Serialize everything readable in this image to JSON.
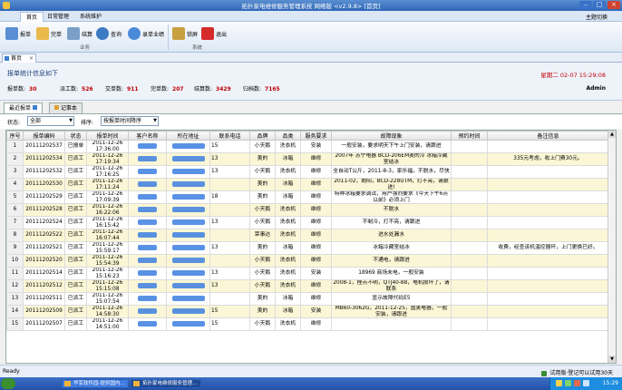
{
  "window": {
    "title": "拓扑家电维修服务管理系统 网络版 <v2.9.8> [首页]",
    "icons": {
      "app": "app-icon",
      "minimize": "minimize-icon",
      "maximize": "maximize-icon",
      "close": "close-icon"
    }
  },
  "menu": {
    "tabs": [
      "首页",
      "日常管理",
      "系统维护"
    ],
    "active": "首页",
    "theme": "主题切换"
  },
  "toolbar": {
    "buttons": [
      {
        "label": "报单",
        "icon": "report-icon"
      },
      {
        "label": "完单",
        "icon": "complete-icon"
      },
      {
        "label": "结算",
        "icon": "settle-icon"
      },
      {
        "label": "查询",
        "icon": "search-icon"
      },
      {
        "label": "录单业绩",
        "icon": "user-icon"
      },
      {
        "label": "锁屏",
        "icon": "lock-icon"
      },
      {
        "label": "退出",
        "icon": "exit-icon"
      }
    ],
    "groups": [
      "业务",
      "系统"
    ]
  },
  "doc_tab": {
    "label": "首页"
  },
  "stats": {
    "title": "报单统计信息如下",
    "datetime": "星期二 02-07 15:29:08",
    "user": "Admin",
    "items": [
      {
        "label": "报单数:",
        "value": "30"
      },
      {
        "label": "派工数:",
        "value": "526"
      },
      {
        "label": "交单数:",
        "value": "911"
      },
      {
        "label": "完单数:",
        "value": "207"
      },
      {
        "label": "结算数:",
        "value": "3429"
      },
      {
        "label": "归档数:",
        "value": "7165"
      }
    ]
  },
  "record_tabs": [
    "最近报单",
    "记事本"
  ],
  "filter": {
    "status_label": "状态:",
    "status_value": "全部",
    "sort_label": "排序:",
    "sort_value": "按报单时间降序"
  },
  "table": {
    "columns": [
      "序号",
      "报单编码",
      "状态",
      "报单时间",
      "客户名称",
      "所在地址",
      "联系电话",
      "品牌",
      "品类",
      "服务要求",
      "故障现象",
      "预约时间",
      "备注信息"
    ],
    "rows": [
      {
        "no": "1",
        "code": "20111202537",
        "status": "已报单",
        "time": "2011-12-26 17:36:00",
        "phone": "15",
        "brand": "小天鹅",
        "category": "洗衣机",
        "service": "安装",
        "fault": "一般安装，要求明天下午上门安装，请跟进",
        "appt": "",
        "note": ""
      },
      {
        "no": "2",
        "code": "20111202534",
        "status": "已派工",
        "time": "2011-12-26 17:19:34",
        "phone": "13",
        "brand": "美的",
        "category": "冰箱",
        "service": "维修",
        "fault": "2007年  苏宁电器  BCD-206EM美的冷  冰箱冷藏室结冰",
        "appt": "",
        "note": "335元考虑，收上门费30元。"
      },
      {
        "no": "3",
        "code": "20111202532",
        "status": "已派工",
        "time": "2011-12-26 17:16:25",
        "phone": "13",
        "brand": "小天鹅",
        "category": "洗衣机",
        "service": "维修",
        "fault": "全自动T公斤，2011-8-3，家乐福，不脱水，尽快",
        "appt": "",
        "note": ""
      },
      {
        "no": "4",
        "code": "20111202530",
        "status": "已派工",
        "time": "2011-12-26 17:11:24",
        "phone": "",
        "brand": "美的",
        "category": "冰箱",
        "service": "维修",
        "fault": "2011-02，朗阳，BCD-228UTM，灯不亮，请跟进!",
        "appt": "",
        "note": ""
      },
      {
        "no": "5",
        "code": "20111202529",
        "status": "已派工",
        "time": "2011-12-26 17:09:39",
        "phone": "18",
        "brand": "美的",
        "category": "冰箱",
        "service": "维修",
        "fault": "特种冰箱要求调试，用户强烈要求《今天下午6点以前》必须上门",
        "appt": "",
        "note": ""
      },
      {
        "no": "6",
        "code": "20111202528",
        "status": "已派工",
        "time": "2011-12-26 16:22:06",
        "phone": "",
        "brand": "小天鹅",
        "category": "洗衣机",
        "service": "维修",
        "fault": "不脱水",
        "appt": "",
        "note": ""
      },
      {
        "no": "7",
        "code": "20111202524",
        "status": "已派工",
        "time": "2011-12-26 16:15:42",
        "phone": "13",
        "brand": "小天鹅",
        "category": "洗衣机",
        "service": "维修",
        "fault": "不制冷，灯不亮，请跟进",
        "appt": "",
        "note": ""
      },
      {
        "no": "8",
        "code": "20111202522",
        "status": "已派工",
        "time": "2011-12-26 16:07:44",
        "phone": "",
        "brand": "荣事达",
        "category": "洗衣机",
        "service": "维修",
        "fault": "进水处漏水",
        "appt": "",
        "note": ""
      },
      {
        "no": "9",
        "code": "20111202521",
        "status": "已派工",
        "time": "2011-12-26 15:59:17",
        "phone": "13",
        "brand": "美的",
        "category": "冰箱",
        "service": "维修",
        "fault": "冰箱冷藏室结冰",
        "appt": "",
        "note": "收费，经查该机温控器坏，上门更换已好。"
      },
      {
        "no": "10",
        "code": "20111202520",
        "status": "已派工",
        "time": "2011-12-26 15:54:39",
        "phone": "",
        "brand": "小天鹅",
        "category": "洗衣机",
        "service": "维修",
        "fault": "不通电，请跟进",
        "appt": "",
        "note": ""
      },
      {
        "no": "11",
        "code": "20111202514",
        "status": "已派工",
        "time": "2011-12-26 15:16:23",
        "phone": "13",
        "brand": "小天鹅",
        "category": "洗衣机",
        "service": "安装",
        "fault": "18969 商场未电，一般安装",
        "appt": "",
        "note": ""
      },
      {
        "no": "12",
        "code": "20111202512",
        "status": "已派工",
        "time": "2011-12-26 15:15:08",
        "phone": "13",
        "brand": "小天鹅",
        "category": "洗衣机",
        "service": "维修",
        "fault": "2008-1，挫点不明，QTJ40-88，电机损坏了，请联系",
        "appt": "",
        "note": ""
      },
      {
        "no": "13",
        "code": "20111202511",
        "status": "已派工",
        "time": "2011-12-26 15:07:54",
        "phone": "",
        "brand": "美的",
        "category": "冰箱",
        "service": "维修",
        "fault": "显示故障代码E5",
        "appt": "",
        "note": ""
      },
      {
        "no": "14",
        "code": "20111202509",
        "status": "已派工",
        "time": "2011-12-26 14:58:30",
        "phone": "15",
        "brand": "美的",
        "category": "冰箱",
        "service": "安装",
        "fault": "MB60-3062G，2011-12-25，国美电器，一般安装，请跟进",
        "appt": "",
        "note": ""
      },
      {
        "no": "15",
        "code": "20111202507",
        "status": "已派工",
        "time": "2011-12-26 14:51:00",
        "phone": "15",
        "brand": "小天鹅",
        "category": "洗衣机",
        "service": "维修",
        "fault": "",
        "appt": "",
        "note": ""
      }
    ]
  },
  "status_bar": {
    "left": "Ready",
    "right": "试用版·登记可以试用30天"
  },
  "taskbar": {
    "tasks": [
      "华军软件园-提供国内...",
      "拓扑家电维修服务管理..."
    ],
    "clock": "15:29"
  }
}
